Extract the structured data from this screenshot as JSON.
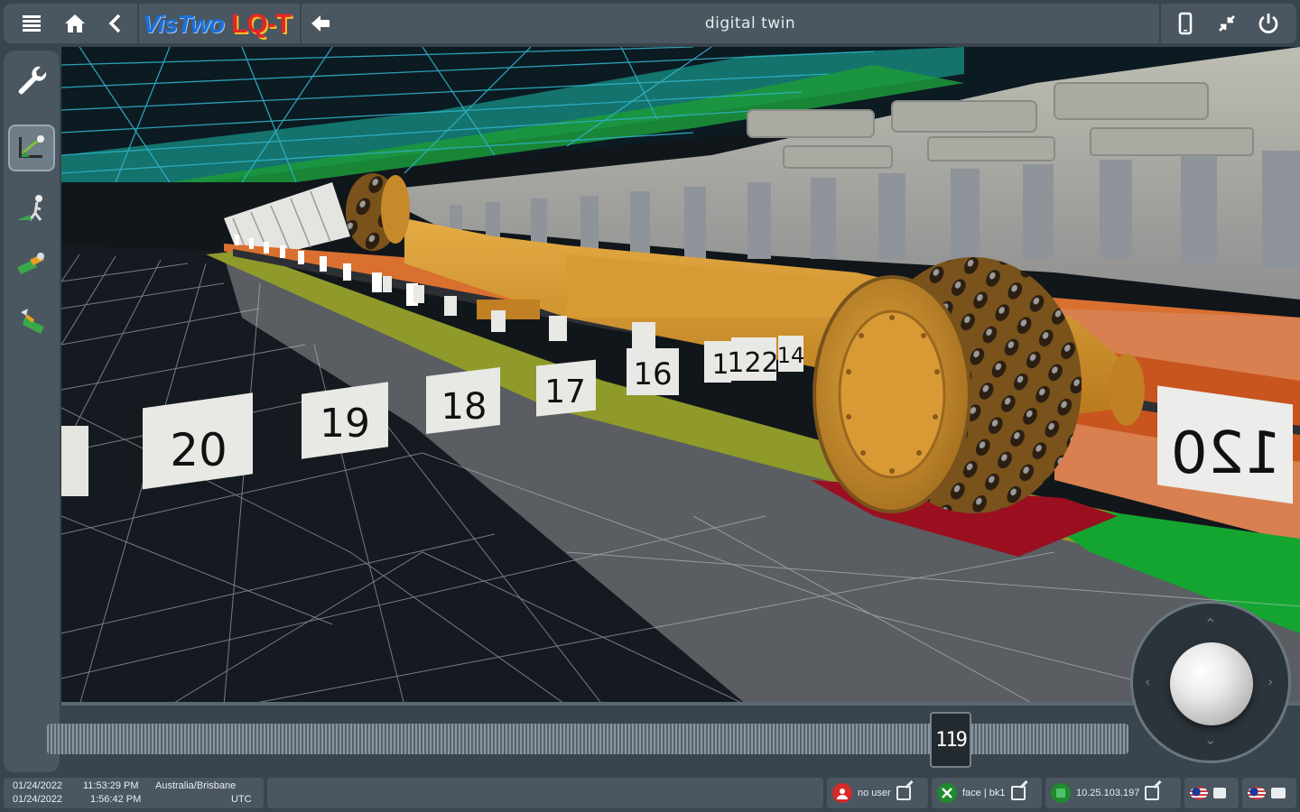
{
  "header": {
    "title": "digital twin",
    "logo_left": "VisTwo",
    "logo_right": "LQ-T"
  },
  "toolbar_icons": {
    "menu": "hamburger-icon",
    "home": "home-icon",
    "back": "chevron-left-icon",
    "forward": "arrow-left-icon",
    "device": "phone-icon",
    "shrink": "compress-icon",
    "power": "power-icon"
  },
  "sidebar": {
    "items": [
      {
        "icon": "wrench-icon"
      },
      {
        "icon": "shearer-view-icon",
        "active": true
      },
      {
        "icon": "shearer-walk-icon"
      },
      {
        "icon": "shearer-drum-icon"
      },
      {
        "icon": "shearer-arm-icon"
      }
    ]
  },
  "scene": {
    "shield_labels": [
      "20",
      "19",
      "18",
      "17",
      "16",
      "1",
      "122",
      "14"
    ],
    "mirrored_label": "120"
  },
  "timeline": {
    "current_value": "119",
    "position": 0.82
  },
  "status": {
    "local_date": "01/24/2022",
    "local_time": "11:53:29 PM",
    "local_zone": "Australia/Brisbane",
    "utc_date": "01/24/2022",
    "utc_time": "1:56:42 PM",
    "utc_zone": "UTC",
    "user": "no user",
    "face": "face | bk1",
    "ip": "10.25.103.197"
  },
  "colors": {
    "accent_orange": "#d97030",
    "machine_yellow": "#d69a2e",
    "wire_cyan": "#2fb0c8",
    "floor_green": "#14a530",
    "floor_red": "#9a1020"
  }
}
